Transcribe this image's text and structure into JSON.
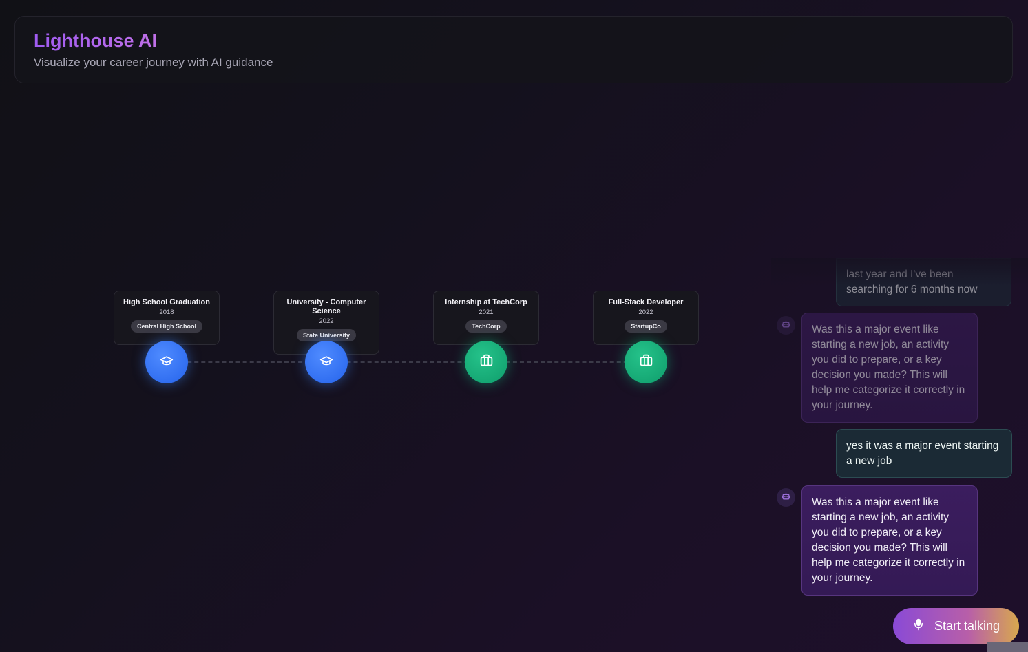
{
  "header": {
    "title": "Lighthouse AI",
    "subtitle": "Visualize your career journey with AI guidance"
  },
  "timeline": {
    "events": [
      {
        "title": "High School Graduation",
        "year": "2018",
        "org": "Central High School",
        "kind": "education",
        "icon": "graduation-cap-icon"
      },
      {
        "title": "University - Computer Science",
        "year": "2022",
        "org": "State University",
        "kind": "education",
        "icon": "graduation-cap-icon"
      },
      {
        "title": "Internship at TechCorp",
        "year": "2021",
        "org": "TechCorp",
        "kind": "work",
        "icon": "briefcase-icon"
      },
      {
        "title": "Full-Stack Developer",
        "year": "2022",
        "org": "StartupCo",
        "kind": "work",
        "icon": "briefcase-icon"
      }
    ]
  },
  "chat": {
    "messages": [
      {
        "role": "user",
        "text": "last year and I've been searching for 6 months now"
      },
      {
        "role": "assistant",
        "text": "Was this a major event like starting a new job, an activity you did to prepare, or a key decision you made? This will help me categorize it correctly in your journey."
      },
      {
        "role": "user",
        "text": "yes it was a major event starting a new job"
      },
      {
        "role": "assistant",
        "text": "Was this a major event like starting a new job, an activity you did to prepare, or a key decision you made? This will help me categorize it correctly in your journey."
      }
    ]
  },
  "controls": {
    "talk_label": "Start talking",
    "talk_icon": "microphone-icon"
  },
  "colors": {
    "accent_purple": "#a35cf0",
    "education_blue": "#3b82f6",
    "work_green": "#10b981"
  }
}
